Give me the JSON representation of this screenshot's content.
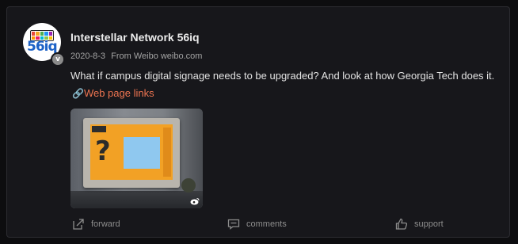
{
  "post": {
    "author": "Interstellar Network 56iq",
    "avatar_text": "56iq",
    "verified_mark": "v",
    "date": "2020-8-3",
    "source": "From Weibo weibo.com",
    "text": "What if campus digital signage needs to be upgraded? And look at how Georgia Tech does it.",
    "link_icon": "link-icon",
    "link_label": "Web page links",
    "media_badge": "weibo-logo-icon"
  },
  "actions": {
    "forward_label": "forward",
    "comments_label": "comments",
    "support_label": "support"
  },
  "colors": {
    "background": "#0d0d0f",
    "card": "#17171b",
    "link": "#eb7350",
    "muted": "#8d8d8d",
    "avatar_text": "#1e63c7"
  }
}
